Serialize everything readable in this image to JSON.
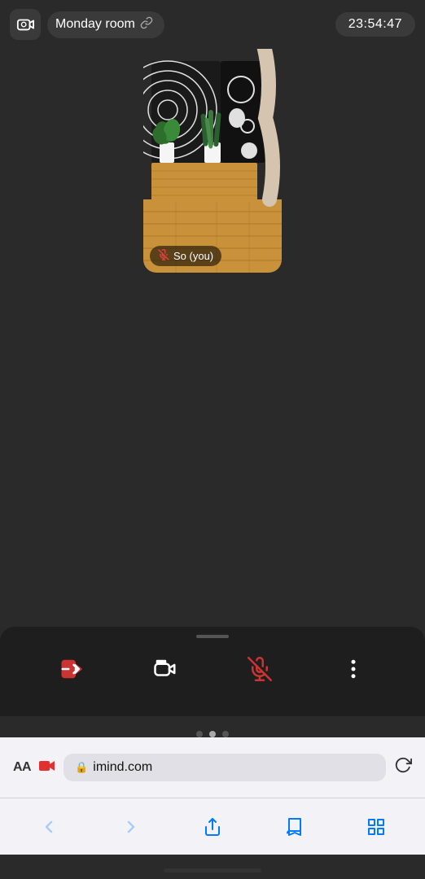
{
  "header": {
    "room_name": "Monday room",
    "time": "23:54:47",
    "camera_icon": "📷",
    "link_icon": "🔗"
  },
  "participant": {
    "name": "So  (you)",
    "mic_muted": true
  },
  "controls": [
    {
      "id": "leave",
      "label": "leave-button",
      "icon": "leave",
      "active": false,
      "color": "#cc3333"
    },
    {
      "id": "camera",
      "label": "camera-button",
      "icon": "camera",
      "active": false,
      "color": "#ffffff"
    },
    {
      "id": "mic",
      "label": "mic-button",
      "icon": "mic-muted",
      "active": true,
      "color": "#cc3333"
    },
    {
      "id": "more",
      "label": "more-button",
      "icon": "more",
      "active": false,
      "color": "#ffffff"
    }
  ],
  "page_dots": [
    {
      "active": false
    },
    {
      "active": true
    },
    {
      "active": false
    }
  ],
  "browser": {
    "aa_label": "AA",
    "url": "imind.com",
    "lock_icon": "🔒"
  },
  "nav": {
    "back_label": "‹",
    "forward_label": "›"
  }
}
